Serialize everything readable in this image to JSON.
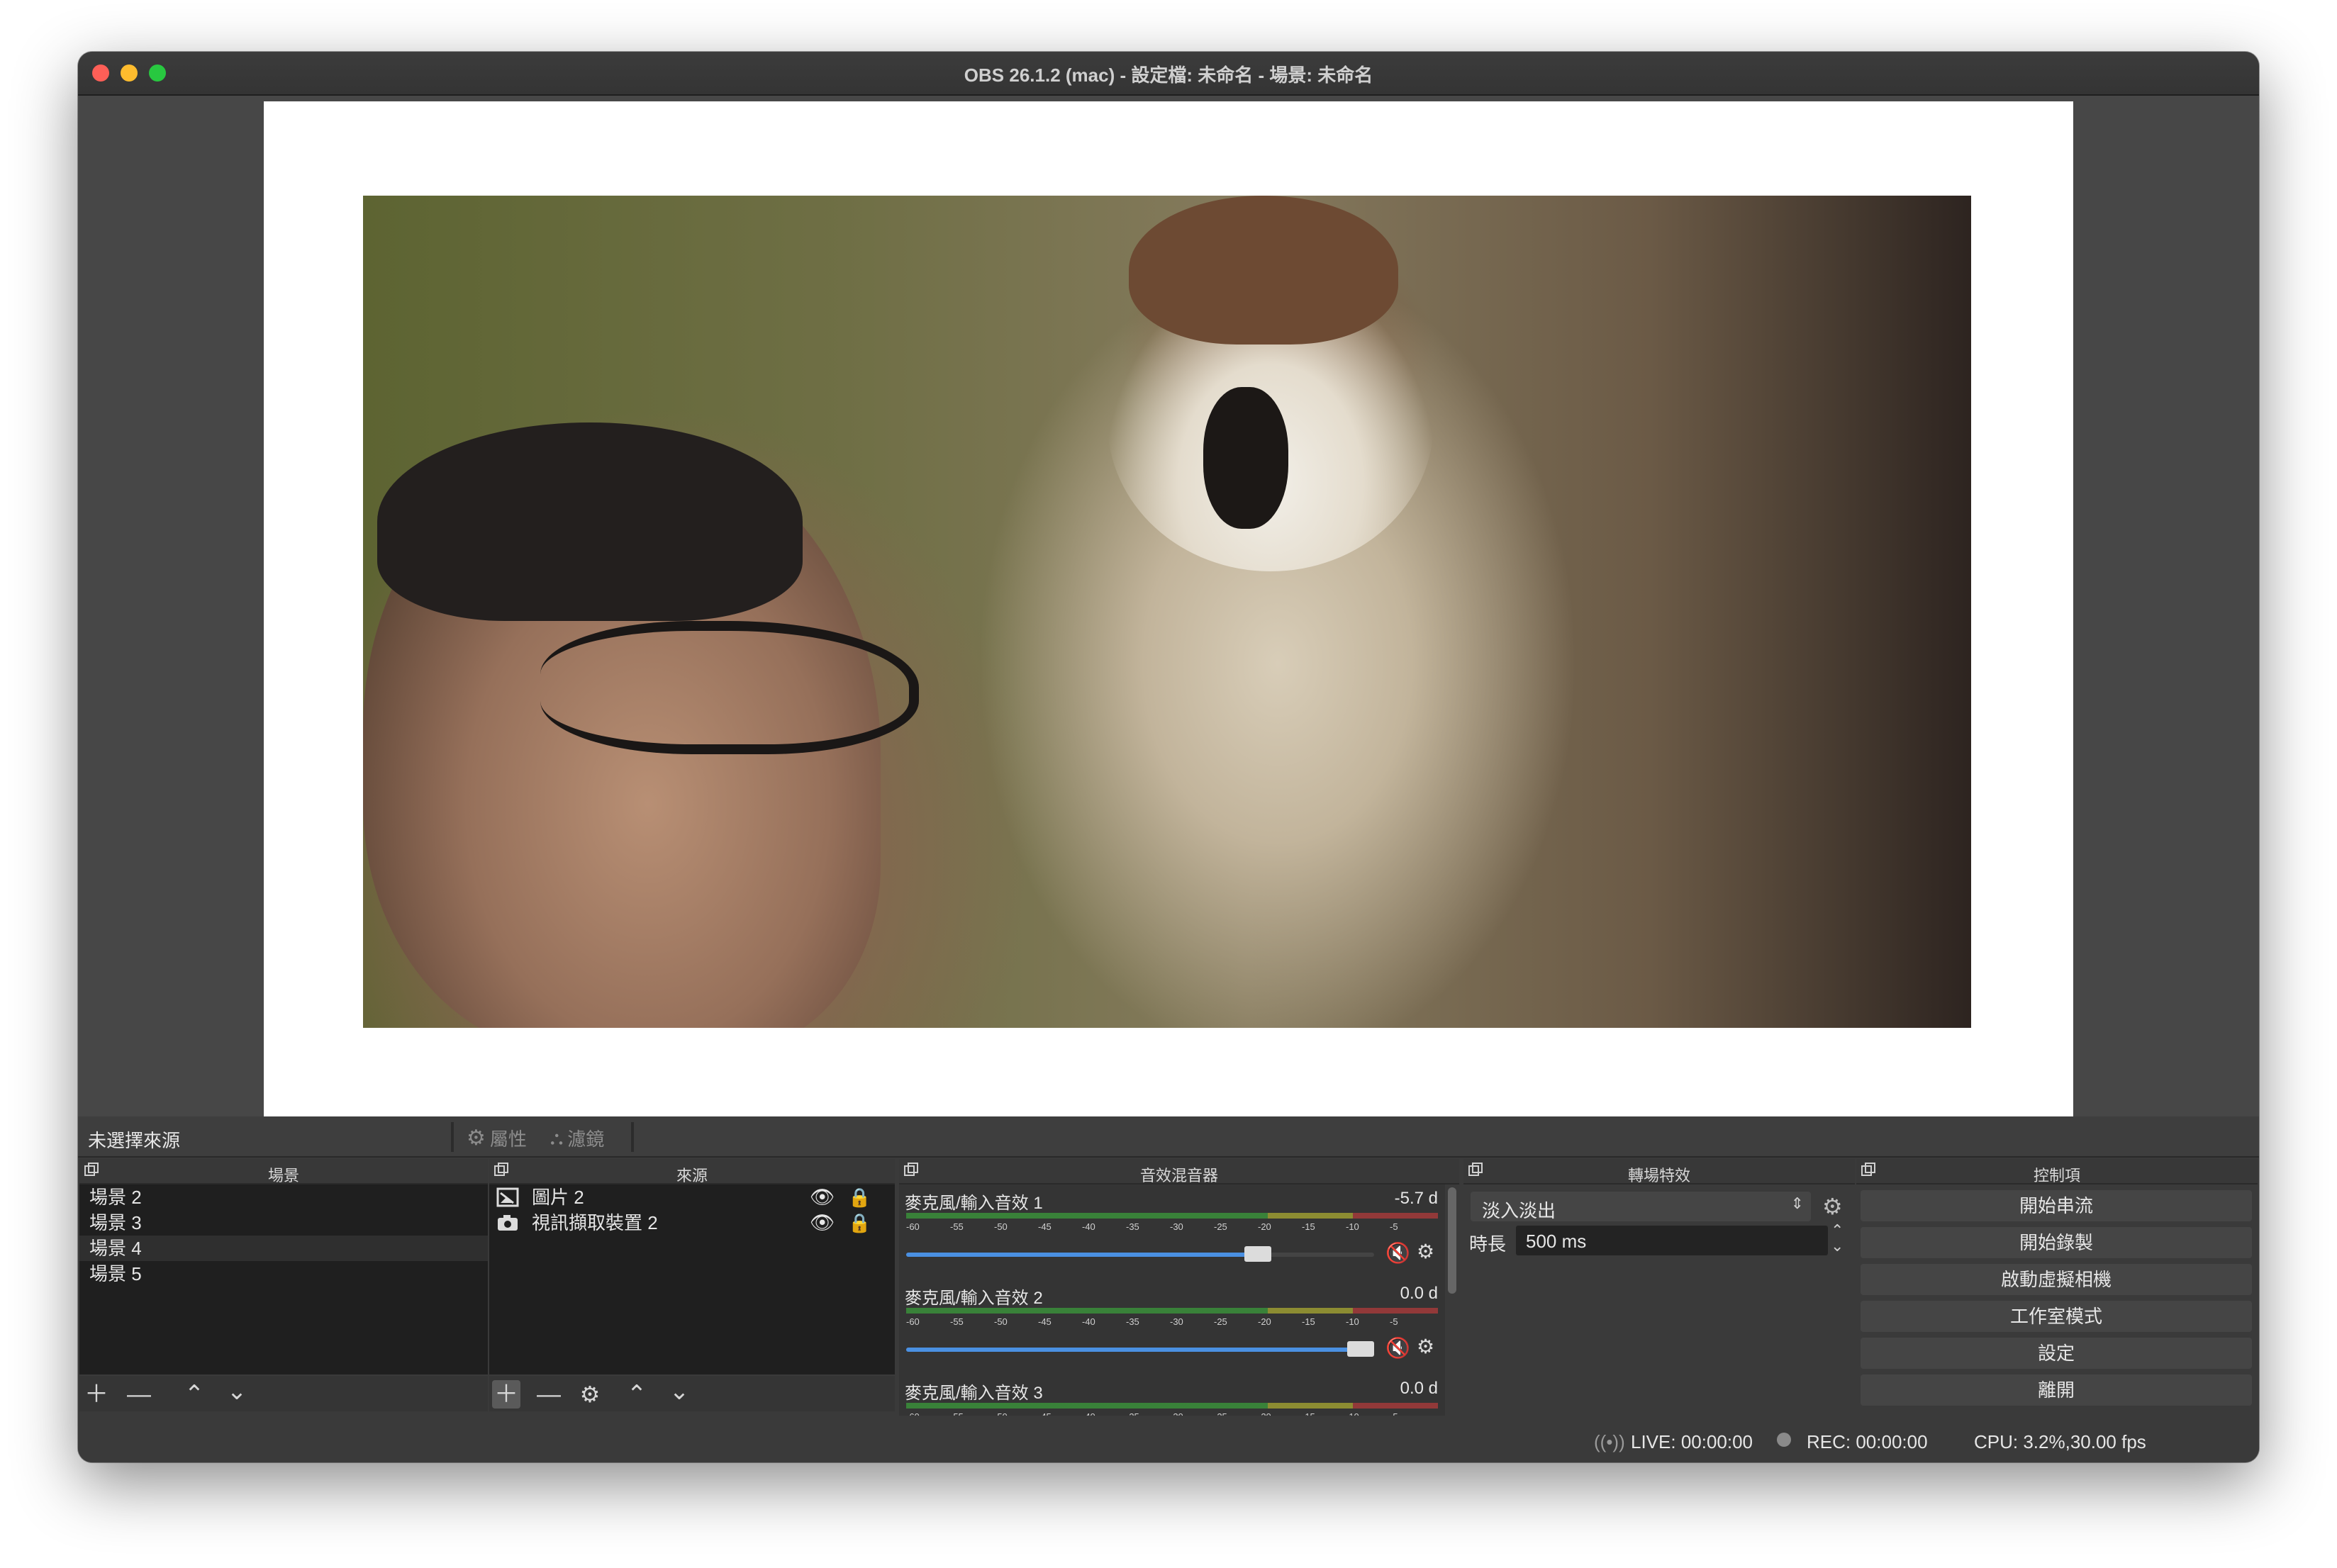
{
  "window": {
    "title": "OBS 26.1.2 (mac) - 設定檔: 未命名 - 場景: 未命名"
  },
  "source_bar": {
    "no_selection": "未選擇來源",
    "properties": "屬性",
    "filters": "濾鏡"
  },
  "scenes": {
    "title": "場景",
    "items": [
      "場景 2",
      "場景 3",
      "場景 4",
      "場景 5"
    ],
    "selected_index": 2
  },
  "sources": {
    "title": "來源",
    "items": [
      {
        "label": "圖片 2",
        "icon": "image-icon"
      },
      {
        "label": "視訊擷取裝置 2",
        "icon": "camera-icon"
      }
    ]
  },
  "mixer": {
    "title": "音效混音器",
    "ticks": [
      "-60",
      "-55",
      "-50",
      "-45",
      "-40",
      "-35",
      "-30",
      "-25",
      "-20",
      "-15",
      "-10",
      "-5"
    ],
    "channels": [
      {
        "name": "麥克風/輸入音效 1",
        "db": "-5.7 d",
        "volume": 0.78
      },
      {
        "name": "麥克風/輸入音效 2",
        "db": "0.0 d",
        "volume": 1.0
      },
      {
        "name": "麥克風/輸入音效 3",
        "db": "0.0 d",
        "volume": 1.0
      }
    ]
  },
  "transitions": {
    "title": "轉場特效",
    "selected": "淡入淡出",
    "duration_label": "時長",
    "duration_value": "500 ms"
  },
  "controls": {
    "title": "控制項",
    "buttons": [
      "開始串流",
      "開始錄製",
      "啟動虛擬相機",
      "工作室模式",
      "設定",
      "離開"
    ]
  },
  "status": {
    "live": "LIVE: 00:00:00",
    "rec": "REC: 00:00:00",
    "cpu": "CPU: 3.2%,30.00 fps"
  }
}
